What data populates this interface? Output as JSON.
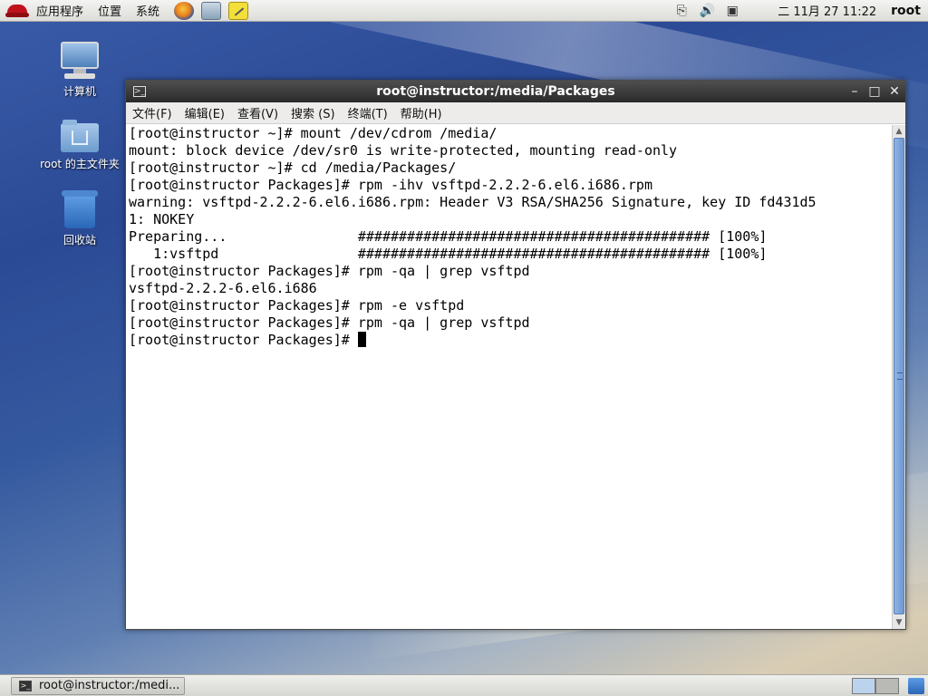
{
  "top_panel": {
    "menus": [
      "应用程序",
      "位置",
      "系统"
    ],
    "clock": "二 11月 27 11:22",
    "user": "root"
  },
  "desktop_icons": [
    {
      "label": "计算机",
      "icon": "computer-icon"
    },
    {
      "label": "root 的主文件夹",
      "icon": "home-folder-icon"
    },
    {
      "label": "回收站",
      "icon": "trash-icon"
    }
  ],
  "window": {
    "title": "root@instructor:/media/Packages",
    "menu": [
      "文件(F)",
      "编辑(E)",
      "查看(V)",
      "搜索 (S)",
      "终端(T)",
      "帮助(H)"
    ],
    "terminal_lines": [
      "[root@instructor ~]# mount /dev/cdrom /media/",
      "mount: block device /dev/sr0 is write-protected, mounting read-only",
      "[root@instructor ~]# cd /media/Packages/",
      "[root@instructor Packages]# rpm -ihv vsftpd-2.2.2-6.el6.i686.rpm",
      "warning: vsftpd-2.2.2-6.el6.i686.rpm: Header V3 RSA/SHA256 Signature, key ID fd431d5",
      "1: NOKEY",
      "Preparing...                ########################################### [100%]",
      "   1:vsftpd                 ########################################### [100%]",
      "[root@instructor Packages]# rpm -qa | grep vsftpd",
      "vsftpd-2.2.2-6.el6.i686",
      "[root@instructor Packages]# rpm -e vsftpd",
      "[root@instructor Packages]# rpm -qa | grep vsftpd"
    ],
    "prompt": "[root@instructor Packages]# "
  },
  "taskbar": {
    "task_label": "root@instructor:/medi..."
  },
  "colors": {
    "titlebar": "#2a2a2a",
    "scroll_thumb": "#6f98d2"
  }
}
